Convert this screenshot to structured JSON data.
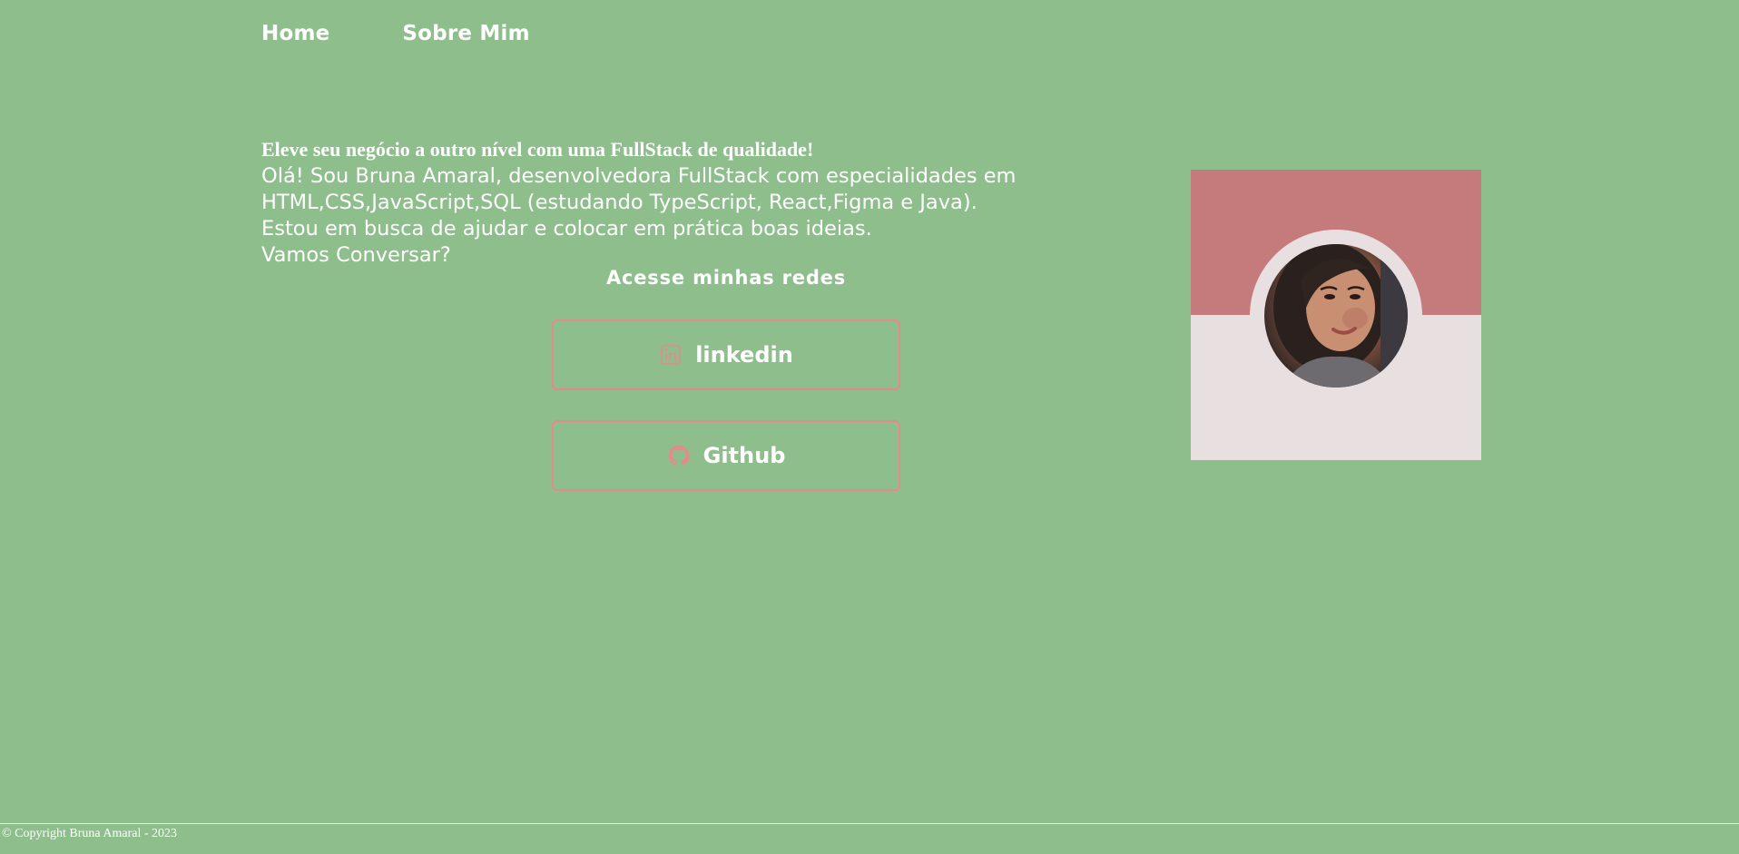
{
  "nav": {
    "items": [
      {
        "label": "Home"
      },
      {
        "label": "Sobre Mim"
      }
    ]
  },
  "intro": {
    "headline": "Eleve seu negócio a outro nível com uma FullStack de qualidade!",
    "lines": [
      "Olá! Sou Bruna Amaral, desenvolvedora FullStack com especialidades em",
      "HTML,CSS,JavaScript,SQL (estudando TypeScript, React,Figma e Java).",
      "Estou em busca de ajudar e colocar em prática boas ideias.",
      "Vamos Conversar?"
    ]
  },
  "socials": {
    "title": "Acesse minhas redes",
    "buttons": [
      {
        "label": "linkedin",
        "icon": "linkedin-icon"
      },
      {
        "label": "Github",
        "icon": "github-icon"
      }
    ]
  },
  "profile": {
    "image": "profile-photo"
  },
  "footer": {
    "text": "© Copyright Bruna Amaral - 2023"
  },
  "colors": {
    "background": "#8fbe8d",
    "accent": "#e58a8a",
    "card_top": "#c57b7b",
    "card_bottom": "#e7dfe0",
    "text": "#ffffff"
  }
}
